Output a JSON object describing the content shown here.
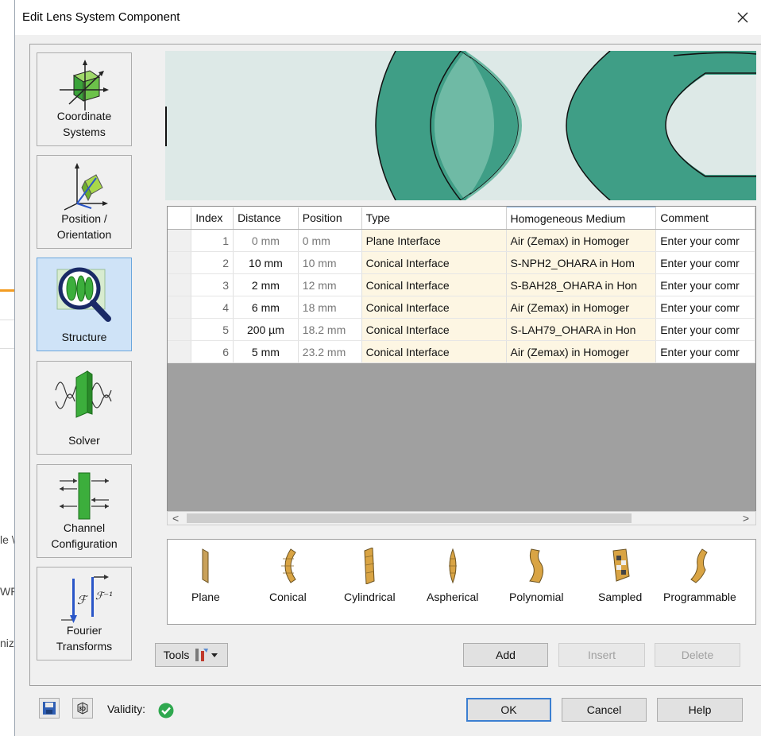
{
  "background": {
    "frag1": "le \\",
    "frag2": "WF",
    "frag3": "nize"
  },
  "dialog": {
    "title": "Edit Lens System Component",
    "close_glyph": "✕"
  },
  "nav": {
    "items": [
      {
        "label_line1": "Coordinate",
        "label_line2": "Systems"
      },
      {
        "label_line1": "Position /",
        "label_line2": "Orientation"
      },
      {
        "label_line1": "Structure",
        "label_line2": ""
      },
      {
        "label_line1": "Solver",
        "label_line2": ""
      },
      {
        "label_line1": "Channel",
        "label_line2": "Configuration"
      },
      {
        "label_line1": "Fourier",
        "label_line2": "Transforms"
      }
    ],
    "active": "Structure"
  },
  "table": {
    "headers": [
      "Index",
      "Distance",
      "Position",
      "Type",
      "Homogeneous Medium",
      "Comment"
    ],
    "rows": [
      {
        "index": "1",
        "distance": "0 mm",
        "position": "0 mm",
        "type": "Plane Interface",
        "medium": "Air (Zemax) in Homoger",
        "comment": "Enter your comr"
      },
      {
        "index": "2",
        "distance": "10 mm",
        "position": "10 mm",
        "type": "Conical Interface",
        "medium": "S-NPH2_OHARA in Hom",
        "comment": "Enter your comr"
      },
      {
        "index": "3",
        "distance": "2 mm",
        "position": "12 mm",
        "type": "Conical Interface",
        "medium": "S-BAH28_OHARA in Hon",
        "comment": "Enter your comr"
      },
      {
        "index": "4",
        "distance": "6 mm",
        "position": "18 mm",
        "type": "Conical Interface",
        "medium": "Air (Zemax) in Homoger",
        "comment": "Enter your comr"
      },
      {
        "index": "5",
        "distance": "200 µm",
        "position": "18.2 mm",
        "type": "Conical Interface",
        "medium": "S-LAH79_OHARA in Hon",
        "comment": "Enter your comr"
      },
      {
        "index": "6",
        "distance": "5 mm",
        "position": "23.2 mm",
        "type": "Conical Interface",
        "medium": "Air (Zemax) in Homoger",
        "comment": "Enter your comr"
      }
    ]
  },
  "scroll": {
    "left": "<",
    "right": ">"
  },
  "palette": {
    "items": [
      "Plane",
      "Conical",
      "Cylindrical",
      "Aspherical",
      "Polynomial",
      "Sampled",
      "Programmable"
    ]
  },
  "actions": {
    "tools": "Tools",
    "add": "Add",
    "insert": "Insert",
    "delete": "Delete"
  },
  "footer": {
    "validity": "Validity:",
    "ok": "OK",
    "cancel": "Cancel",
    "help": "Help"
  },
  "colors": {
    "lens_dark": "#3f9e86",
    "lens_light": "#6fbaa5",
    "preview_bg": "#dde9e7",
    "active_nav": "#cfe3f7",
    "validity_ok": "#2fa84f"
  }
}
